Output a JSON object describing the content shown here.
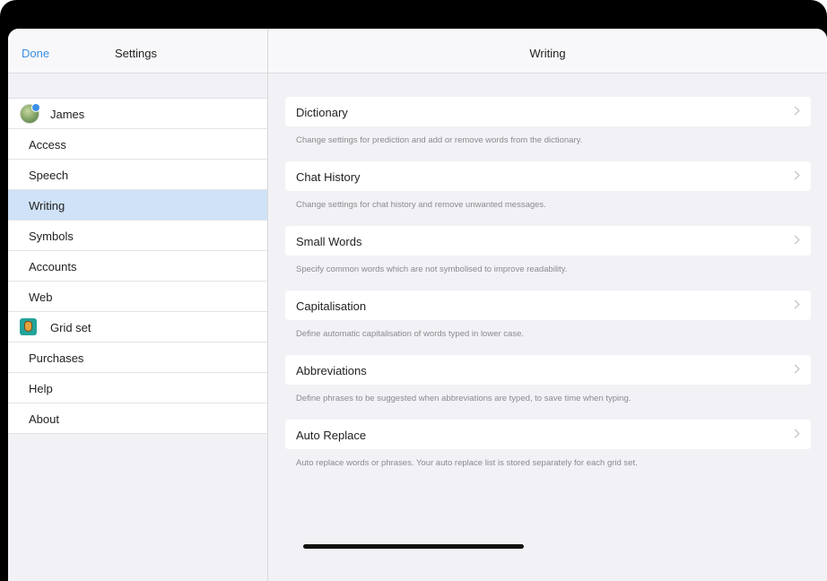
{
  "sidebar": {
    "done_label": "Done",
    "title": "Settings",
    "items": [
      {
        "label": "James",
        "icon": "avatar"
      },
      {
        "label": "Access"
      },
      {
        "label": "Speech"
      },
      {
        "label": "Writing",
        "selected": true
      },
      {
        "label": "Symbols"
      },
      {
        "label": "Accounts"
      },
      {
        "label": "Web"
      },
      {
        "label": "Grid set",
        "icon": "grid-set-icon"
      },
      {
        "label": "Purchases"
      },
      {
        "label": "Help"
      },
      {
        "label": "About"
      }
    ]
  },
  "main": {
    "title": "Writing",
    "rows": [
      {
        "label": "Dictionary",
        "description": "Change settings for prediction and add or remove words from the dictionary."
      },
      {
        "label": "Chat History",
        "description": "Change settings for chat history and remove unwanted messages."
      },
      {
        "label": "Small Words",
        "description": "Specify common words which are not symbolised to improve readability."
      },
      {
        "label": "Capitalisation",
        "description": "Define automatic capitalisation of words typed in lower case."
      },
      {
        "label": "Abbreviations",
        "description": "Define phrases to be suggested when abbreviations are typed, to save time when typing."
      },
      {
        "label": "Auto Replace",
        "description": "Auto replace words or phrases.  Your auto replace list is stored separately for each grid set."
      }
    ]
  },
  "colors": {
    "accent": "#3b8ee6",
    "selected_row": "#cfe2f7"
  }
}
